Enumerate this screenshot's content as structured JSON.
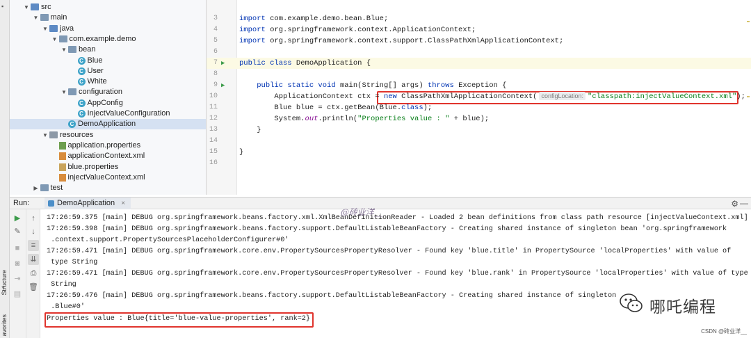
{
  "tool_strip": {
    "structure_label": "Structure",
    "favorites_label": "avorites"
  },
  "project_tree": {
    "items": [
      {
        "label": "src",
        "kind": "folder-src",
        "indent": 0,
        "expanded": true
      },
      {
        "label": "main",
        "kind": "folder",
        "indent": 1,
        "expanded": true
      },
      {
        "label": "java",
        "kind": "folder-src",
        "indent": 2,
        "expanded": true
      },
      {
        "label": "com.example.demo",
        "kind": "folder",
        "indent": 3,
        "expanded": true
      },
      {
        "label": "bean",
        "kind": "folder",
        "indent": 4,
        "expanded": true
      },
      {
        "label": "Blue",
        "kind": "class",
        "indent": 5
      },
      {
        "label": "User",
        "kind": "class",
        "indent": 5
      },
      {
        "label": "White",
        "kind": "class",
        "indent": 5
      },
      {
        "label": "configuration",
        "kind": "folder",
        "indent": 4,
        "expanded": true
      },
      {
        "label": "AppConfig",
        "kind": "class",
        "indent": 5
      },
      {
        "label": "InjectValueConfiguration",
        "kind": "class",
        "indent": 5
      },
      {
        "label": "DemoApplication",
        "kind": "class",
        "indent": 4,
        "selected": true
      },
      {
        "label": "resources",
        "kind": "folder-res",
        "indent": 2,
        "expanded": true
      },
      {
        "label": "application.properties",
        "kind": "props",
        "indent": 3
      },
      {
        "label": "applicationContext.xml",
        "kind": "xml",
        "indent": 3
      },
      {
        "label": "blue.properties",
        "kind": "file",
        "indent": 3
      },
      {
        "label": "injectValueContext.xml",
        "kind": "xml",
        "indent": 3
      },
      {
        "label": "test",
        "kind": "folder",
        "indent": 1,
        "expanded": false
      }
    ]
  },
  "editor": {
    "lines": [
      {
        "n": "3",
        "tokens": [
          [
            "kw",
            "import"
          ],
          [
            "",
            " com.example.demo.bean.Blue;"
          ]
        ]
      },
      {
        "n": "4",
        "tokens": [
          [
            "kw",
            "import"
          ],
          [
            "",
            " org.springframework.context.ApplicationContext;"
          ]
        ]
      },
      {
        "n": "5",
        "tokens": [
          [
            "kw",
            "import"
          ],
          [
            "",
            " org.springframework.context.support.ClassPathXmlApplicationContext;"
          ]
        ]
      },
      {
        "n": "6",
        "tokens": []
      },
      {
        "n": "7",
        "run": true,
        "current": true,
        "tokens": [
          [
            "kw",
            "public class"
          ],
          [
            "",
            " DemoApplication {"
          ]
        ]
      },
      {
        "n": "8",
        "tokens": []
      },
      {
        "n": "9",
        "run": true,
        "tokens": [
          [
            "",
            "    "
          ],
          [
            "kw",
            "public static void"
          ],
          [
            "",
            " main(String[] args) "
          ],
          [
            "kw",
            "throws"
          ],
          [
            "",
            " Exception {"
          ]
        ]
      },
      {
        "n": "10",
        "tokens": [
          [
            "",
            "        ApplicationContext ctx = "
          ],
          [
            "kw",
            "new"
          ],
          [
            "",
            " ClassPathXmlApplicationContext("
          ],
          [
            "hint",
            "configLocation:"
          ],
          [
            "str",
            "\"classpath:injectValueContext.xml\""
          ],
          [
            "",
            ");"
          ]
        ]
      },
      {
        "n": "11",
        "tokens": [
          [
            "",
            "        Blue blue = ctx.getBean(Blue."
          ],
          [
            "kw",
            "class"
          ],
          [
            "",
            ");"
          ]
        ]
      },
      {
        "n": "12",
        "tokens": [
          [
            "",
            "        System."
          ],
          [
            "italic",
            "out"
          ],
          [
            "",
            ".println("
          ],
          [
            "str",
            "\"Properties value : \""
          ],
          [
            "",
            " + blue);"
          ]
        ]
      },
      {
        "n": "13",
        "tokens": [
          [
            "",
            "    }"
          ]
        ]
      },
      {
        "n": "14",
        "tokens": []
      },
      {
        "n": "15",
        "tokens": [
          [
            "",
            "}"
          ]
        ]
      },
      {
        "n": "16",
        "tokens": []
      }
    ]
  },
  "run_panel": {
    "label": "Run:",
    "tab_label": "DemoApplication",
    "tab_close": "×",
    "settings_icon": "⚙",
    "minimize_icon": "—",
    "log_lines": [
      "17:26:59.375 [main] DEBUG org.springframework.beans.factory.xml.XmlBeanDefinitionReader - Loaded 2 bean definitions from class path resource [injectValueContext.xml]",
      "17:26:59.398 [main] DEBUG org.springframework.beans.factory.support.DefaultListableBeanFactory - Creating shared instance of singleton bean 'org.springframework",
      " .context.support.PropertySourcesPlaceholderConfigurer#0'",
      "17:26:59.471 [main] DEBUG org.springframework.core.env.PropertySourcesPropertyResolver - Found key 'blue.title' in PropertySource 'localProperties' with value of",
      " type String",
      "17:26:59.471 [main] DEBUG org.springframework.core.env.PropertySourcesPropertyResolver - Found key 'blue.rank' in PropertySource 'localProperties' with value of type",
      " String",
      "17:26:59.476 [main] DEBUG org.springframework.beans.factory.support.DefaultListableBeanFactory - Creating shared instance of singleton",
      " .Blue#0'",
      "Properties value : Blue{title='blue-value-properties', rank=2}"
    ]
  },
  "watermarks": {
    "top_signature": "@砖业洋__",
    "wechat_name": "哪吒编程",
    "csdn": "CSDN @砖业洋__"
  },
  "colors": {
    "highlight_box": "#e0342d",
    "keyword": "#0033b3",
    "string": "#067d17",
    "selection": "#d5e1f2"
  }
}
